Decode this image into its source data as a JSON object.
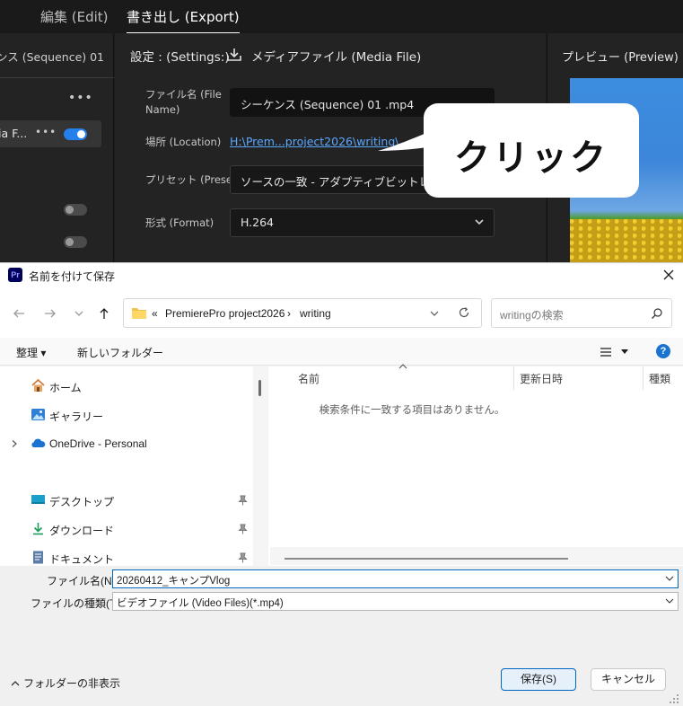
{
  "premiere": {
    "menu_edit": "編集 (Edit)",
    "menu_export": "書き出し (Export)",
    "left_panel_title": "ンス (Sequence) 01",
    "left_row_label": "ia F...",
    "settings_label": "設定 : (Settings:)",
    "media_file_label": "メディアファイル (Media File)",
    "file_name_label": "ファイル名 (File Name)",
    "file_name_value": "シーケンス (Sequence) 01 .mp4",
    "location_label": "場所 (Location)",
    "location_value": "H:\\Prem...project2026\\writing\\",
    "preset_label": "プリセット (Preset)",
    "preset_value": "ソースの一致 - アダプティブビットレート (",
    "format_label": "形式 (Format)",
    "format_value": "H.264",
    "preview_title": "プレビュー (Preview)"
  },
  "callout": {
    "text": "クリック"
  },
  "dialog": {
    "title": "名前を付けて保存",
    "app_icon_text": "Pr",
    "breadcrumb": [
      "PremierePro project2026",
      "writing"
    ],
    "breadcrumb_prefix": "«",
    "search_placeholder": "writingの検索",
    "organize": "整理 ▾",
    "new_folder": "新しいフォルダー",
    "help": "?",
    "nav_items": [
      {
        "label": "ホーム",
        "icon": "home-icon"
      },
      {
        "label": "ギャラリー",
        "icon": "gallery-icon"
      },
      {
        "label": "OneDrive - Personal",
        "icon": "onedrive-icon"
      },
      {
        "label": "デスクトップ",
        "icon": "desktop-icon"
      },
      {
        "label": "ダウンロード",
        "icon": "download-icon"
      },
      {
        "label": "ドキュメント",
        "icon": "document-icon"
      }
    ],
    "columns": [
      "名前",
      "更新日時",
      "種類"
    ],
    "empty_message": "検索条件に一致する項目はありません。",
    "file_name_label": "ファイル名(N):",
    "file_name_value": "20260412_キャンプVlog",
    "file_type_label": "ファイルの種類(T):",
    "file_type_value": "ビデオファイル (Video Files)(*.mp4)",
    "hide_folders": "フォルダーの非表示",
    "save_button": "保存(S)",
    "cancel_button": "キャンセル"
  },
  "colors": {
    "accent": "#2680eb",
    "link": "#5aa8ff",
    "dialog_primary_border": "#0067c0"
  }
}
